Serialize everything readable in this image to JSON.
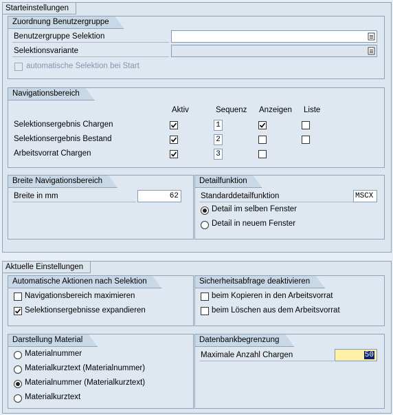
{
  "start": {
    "title": "Starteinstellungen",
    "zuordnung": {
      "title": "Zuordnung Benutzergruppe",
      "benutzergruppe_label": "Benutzergruppe Selektion",
      "benutzergruppe_value": "",
      "variante_label": "Selektionsvariante",
      "variante_value": "",
      "auto_selektion_label": "automatische Selektion bei Start",
      "auto_selektion_checked": false
    },
    "navigation": {
      "title": "Navigationsbereich",
      "headers": {
        "aktiv": "Aktiv",
        "sequenz": "Sequenz",
        "anzeigen": "Anzeigen",
        "liste": "Liste"
      },
      "rows": [
        {
          "label": "Selektionsergebnis Chargen",
          "aktiv": true,
          "sequenz": "1",
          "anzeigen": true,
          "liste": false
        },
        {
          "label": "Selektionsergebnis Bestand",
          "aktiv": true,
          "sequenz": "2",
          "anzeigen": false,
          "liste": false
        },
        {
          "label": "Arbeitsvorrat Chargen",
          "aktiv": true,
          "sequenz": "3",
          "anzeigen": false
        }
      ]
    },
    "breite": {
      "title": "Breite Navigationsbereich",
      "label": "Breite in mm",
      "value": "62"
    },
    "detail": {
      "title": "Detailfunktion",
      "label": "Standarddetailfunktion",
      "value": "MSCX",
      "options": [
        {
          "label": "Detail im selben Fenster",
          "selected": true
        },
        {
          "label": "Detail in neuem Fenster",
          "selected": false
        }
      ]
    }
  },
  "current": {
    "title": "Aktuelle Einstellungen",
    "auto_aktionen": {
      "title": "Automatische Aktionen nach Selektion",
      "items": [
        {
          "label": "Navigationsbereich maximieren",
          "checked": false
        },
        {
          "label": "Selektionsergebnisse expandieren",
          "checked": true
        }
      ]
    },
    "sicherheit": {
      "title": "Sicherheitsabfrage deaktivieren",
      "items": [
        {
          "label": "beim Kopieren in den Arbeitsvorrat",
          "checked": false
        },
        {
          "label": "beim Löschen aus dem Arbeitsvorrat",
          "checked": false
        }
      ]
    },
    "darstellung": {
      "title": "Darstellung Material",
      "options": [
        {
          "label": "Materialnummer",
          "selected": false
        },
        {
          "label": "Materialkurztext (Materialnummer)",
          "selected": false
        },
        {
          "label": "Materialnummer (Materialkurztext)",
          "selected": true
        },
        {
          "label": "Materialkurztext",
          "selected": false
        }
      ]
    },
    "datenbank": {
      "title": "Datenbankbegrenzung",
      "label": "Maximale Anzahl Chargen",
      "value": "50"
    }
  }
}
